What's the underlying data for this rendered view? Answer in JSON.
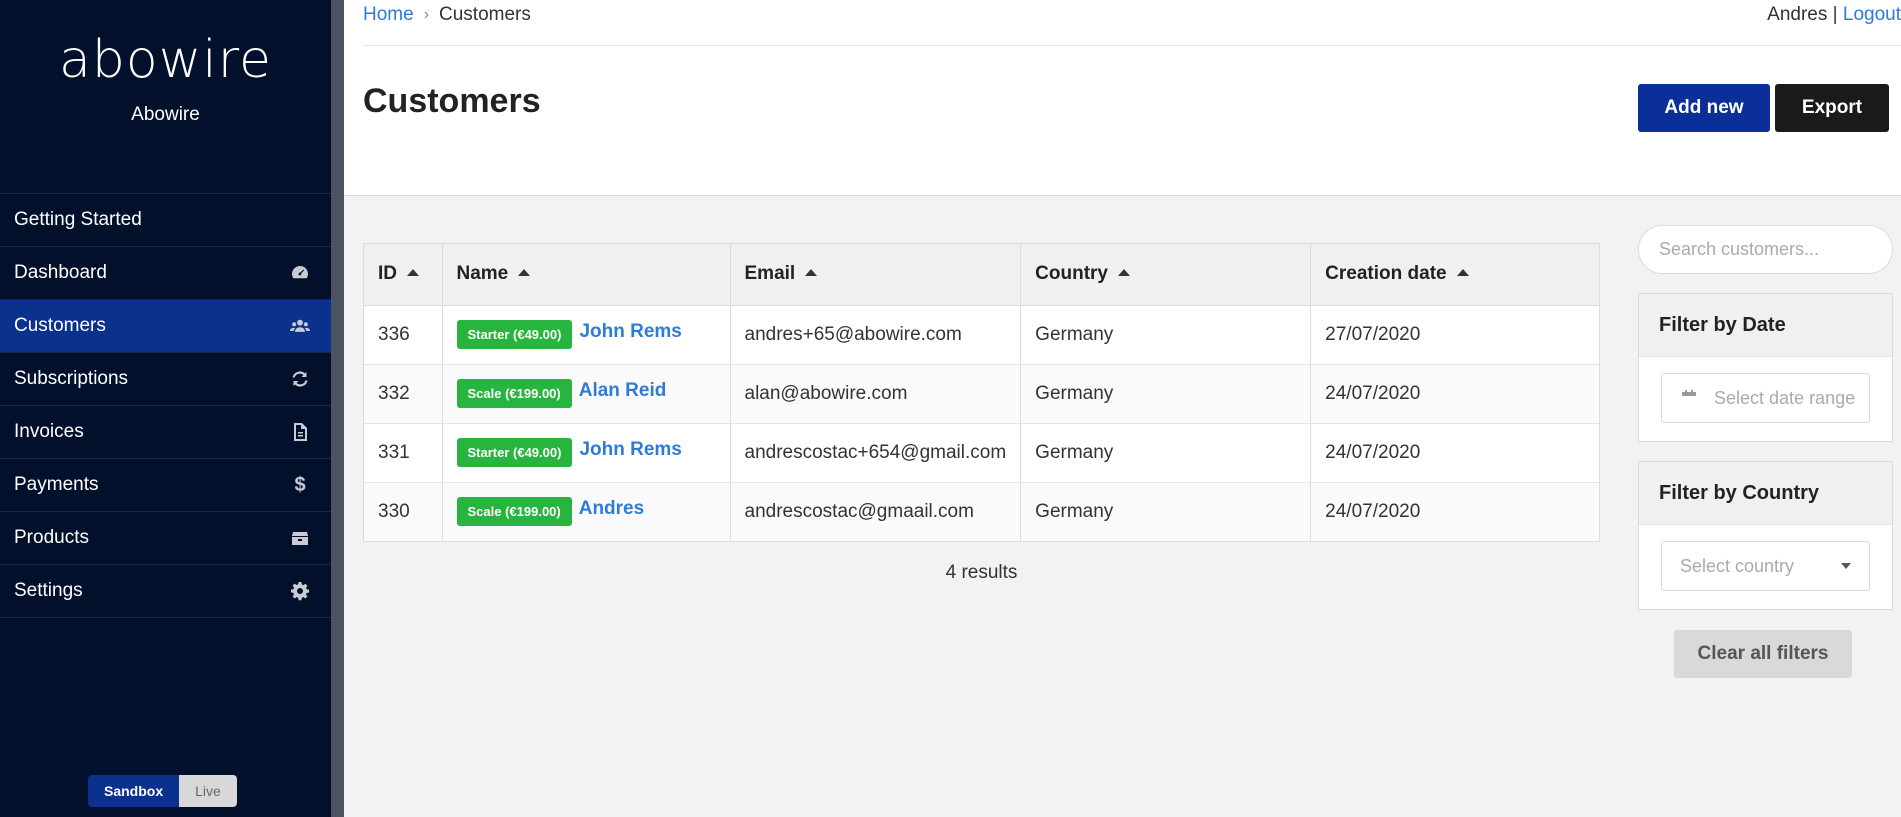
{
  "sidebar": {
    "logo_text": "abowire",
    "brand_name": "Abowire",
    "items": [
      {
        "label": "Getting Started",
        "icon": "none",
        "active": false
      },
      {
        "label": "Dashboard",
        "icon": "tachometer-icon",
        "active": false
      },
      {
        "label": "Customers",
        "icon": "users-icon",
        "active": true
      },
      {
        "label": "Subscriptions",
        "icon": "refresh-icon",
        "active": false
      },
      {
        "label": "Invoices",
        "icon": "document-icon",
        "active": false
      },
      {
        "label": "Payments",
        "icon": "dollar-icon",
        "active": false
      },
      {
        "label": "Products",
        "icon": "box-icon",
        "active": false
      },
      {
        "label": "Settings",
        "icon": "gear-icon",
        "active": false
      }
    ],
    "env_toggle": {
      "sandbox": "Sandbox",
      "live": "Live",
      "selected": "Sandbox"
    }
  },
  "header": {
    "breadcrumb": {
      "home": "Home",
      "current": "Customers"
    },
    "user_name": "Andres",
    "separator": "|",
    "logout": "Logout",
    "title": "Customers",
    "add_new": "Add new",
    "export": "Export"
  },
  "table": {
    "columns": [
      "ID",
      "Name",
      "Email",
      "Country",
      "Creation date"
    ],
    "rows": [
      {
        "id": "336",
        "plan": "Starter (€49.00)",
        "name": "John Rems",
        "email": "andres+65@abowire.com",
        "country": "Germany",
        "created": "27/07/2020"
      },
      {
        "id": "332",
        "plan": "Scale (€199.00)",
        "name": "Alan Reid",
        "email": "alan@abowire.com",
        "country": "Germany",
        "created": "24/07/2020"
      },
      {
        "id": "331",
        "plan": "Starter (€49.00)",
        "name": "John Rems",
        "email": "andrescostac+654@gmail.com",
        "country": "Germany",
        "created": "24/07/2020"
      },
      {
        "id": "330",
        "plan": "Scale (€199.00)",
        "name": "Andres",
        "email": "andrescostac@gmaail.com",
        "country": "Germany",
        "created": "24/07/2020"
      }
    ],
    "results": "4 results"
  },
  "filters": {
    "search_placeholder": "Search customers...",
    "date_title": "Filter by Date",
    "date_placeholder": "Select date range",
    "country_title": "Filter by Country",
    "country_placeholder": "Select country",
    "clear": "Clear all filters"
  },
  "colors": {
    "sidebar_bg": "#03102b",
    "primary": "#0b318f",
    "badge_green": "#27b53f",
    "link": "#2e7cd6"
  }
}
